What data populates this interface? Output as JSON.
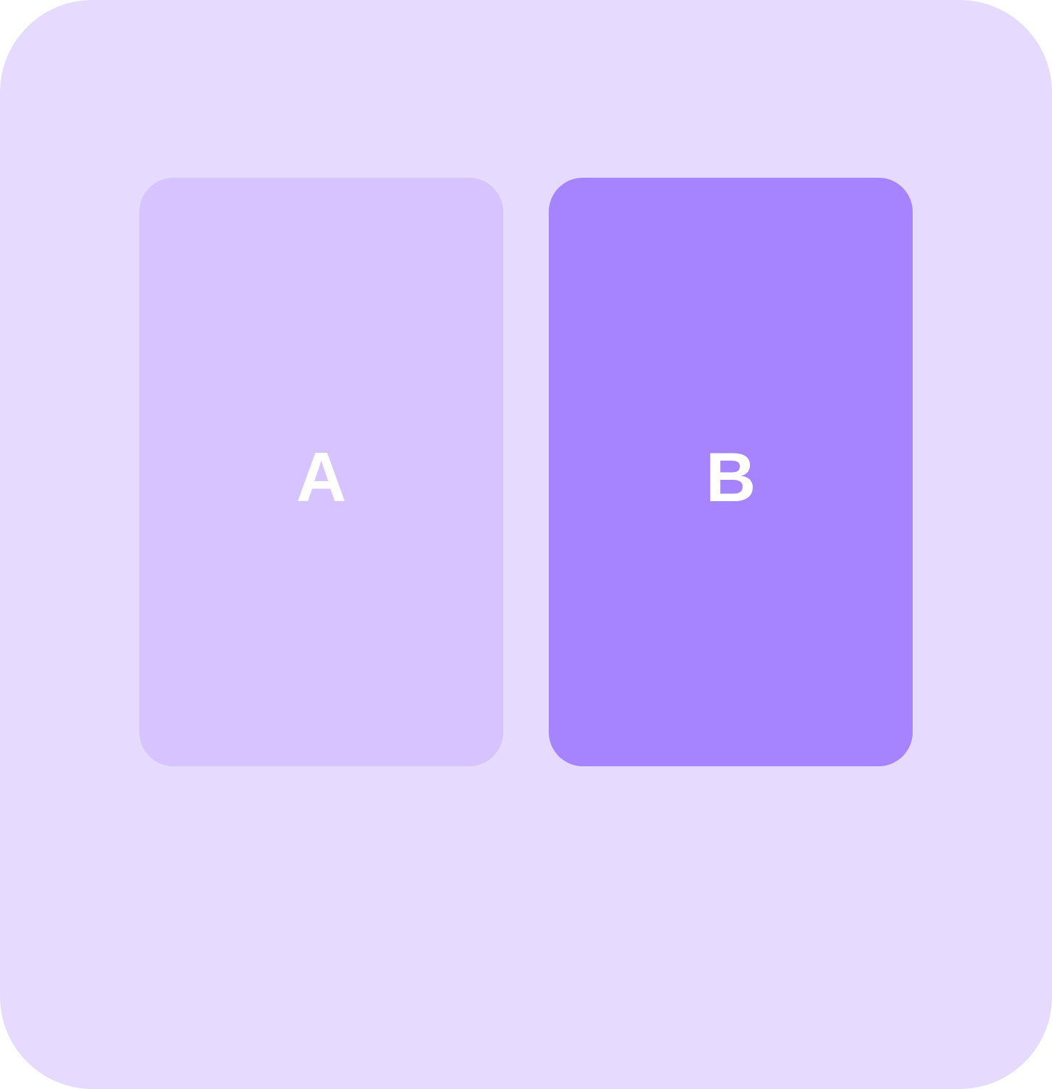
{
  "colors": {
    "background": "#E6DBFE",
    "panel_a": "#D7C3FF",
    "panel_b": "#A784FF",
    "label": "#FFFFFF"
  },
  "panels": [
    {
      "label": "A"
    },
    {
      "label": "B"
    }
  ]
}
